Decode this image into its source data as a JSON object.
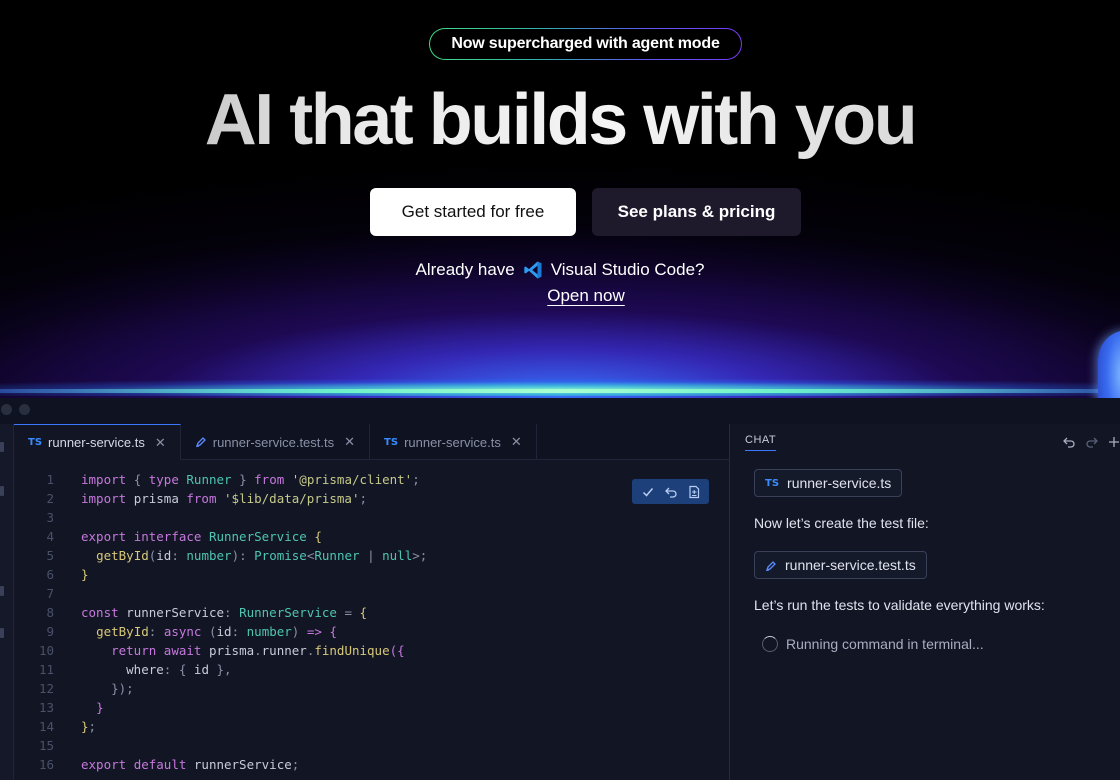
{
  "hero": {
    "badge": "Now supercharged with agent mode",
    "headline": "AI that builds with you",
    "cta_primary": "Get started for free",
    "cta_secondary": "See plans & pricing",
    "already_have_prefix": "Already have",
    "already_have_product": "Visual Studio Code?",
    "open_now": "Open now"
  },
  "editor": {
    "tabs": [
      {
        "icon": "TS",
        "label": "runner-service.ts",
        "active": true
      },
      {
        "icon": "pen-icon",
        "label": "runner-service.test.ts",
        "active": false
      },
      {
        "icon": "TS",
        "label": "runner-service.ts",
        "active": false
      }
    ],
    "line_numbers": [
      "1",
      "2",
      "3",
      "4",
      "5",
      "6",
      "7",
      "8",
      "9",
      "10",
      "11",
      "12",
      "13",
      "14",
      "15",
      "16"
    ]
  },
  "chat": {
    "tab_label": "CHAT",
    "file_chip_1_icon": "TS",
    "file_chip_1": "runner-service.ts",
    "message_1": "Now let’s create the test file:",
    "file_chip_2": "runner-service.test.ts",
    "message_2": "Let’s run the tests to validate everything works:",
    "running": "Running command in terminal..."
  },
  "colors": {
    "accent_blue": "#3c78ff",
    "keyword": "#c678dd",
    "string": "#c5c98a",
    "type": "#4fc4b0"
  }
}
